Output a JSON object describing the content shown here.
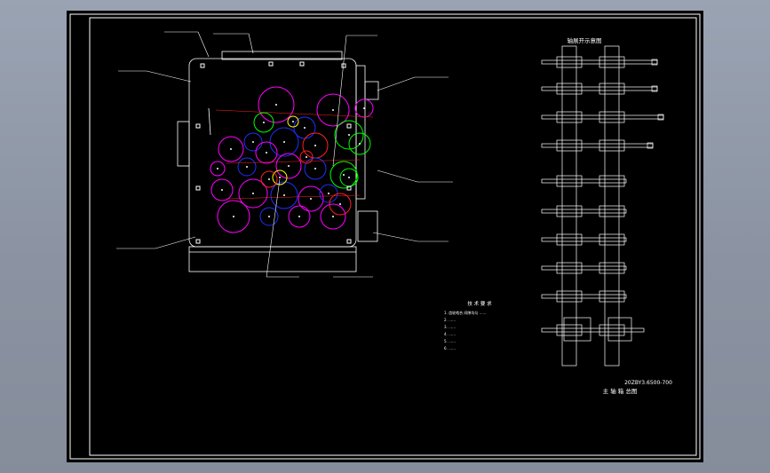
{
  "drawing": {
    "title_block": {
      "name": "主 轴 箱 总图",
      "code": "20ZBY3.6500-700"
    },
    "right_view_title": "轴展开示意图",
    "tech_requirements": {
      "heading": "技 术 要 求",
      "lines": [
        "1. 齿轮啮合 间隙均匀 ……",
        "2. ……",
        "3. ……",
        "4. ……",
        "5. ……",
        "6. ……"
      ]
    },
    "colors": {
      "background": "#000000",
      "lines": "#ffffff",
      "gear_magenta": "#ff00ff",
      "gear_blue": "#2030ff",
      "gear_green": "#00ff00",
      "gear_red": "#ff2020",
      "gear_yellow": "#ffff00"
    }
  }
}
